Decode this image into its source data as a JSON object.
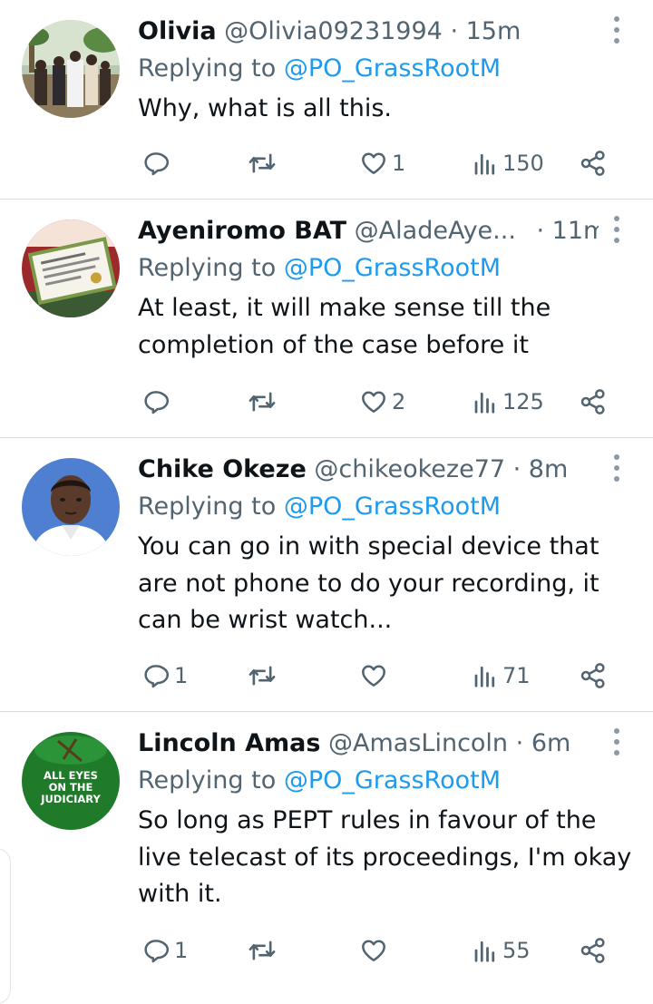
{
  "tweets": [
    {
      "name": "Olivia",
      "handle": "@Olivia09231994",
      "time": "· 15m",
      "replying_prefix": "Replying to",
      "replying_handle": "@PO_GrassRootM",
      "text": "Why, what is all this.",
      "replies": "",
      "retweets": "",
      "likes": "1",
      "views": "150",
      "avatar": "group-photo"
    },
    {
      "name": "Ayeniromo BAT",
      "handle": "@AladeAye...",
      "time": "· 11m",
      "replying_prefix": "Replying to",
      "replying_handle": "@PO_GrassRootM",
      "text": "At least, it will make sense till the completion of the case before it",
      "replies": "",
      "retweets": "",
      "likes": "2",
      "views": "125",
      "avatar": "certificate-photo"
    },
    {
      "name": "Chike Okeze",
      "handle": "@chikeokeze77",
      "time": "· 8m",
      "replying_prefix": "Replying to",
      "replying_handle": "@PO_GrassRootM",
      "text": "You can go in with special device that are not phone to do your recording, it can be wrist watch...",
      "replies": "1",
      "retweets": "",
      "likes": "",
      "views": "71",
      "avatar": "portrait-photo"
    },
    {
      "name": "Lincoln Amas",
      "handle": "@AmasLincoln",
      "time": "· 6m",
      "replying_prefix": "Replying to",
      "replying_handle": "@PO_GrassRootM",
      "text": "So long as PEPT rules in favour of the live telecast of its proceedings, I'm okay with it.",
      "replies": "1",
      "retweets": "",
      "likes": "",
      "views": "55",
      "avatar": "logo",
      "avatar_text": [
        "ALL EYES",
        "ON THE",
        "JUDICIARY"
      ]
    }
  ],
  "colors": {
    "text": "#0f1419",
    "muted": "#536471",
    "link": "#1d9bf0",
    "divider": "#d7dbdf"
  }
}
